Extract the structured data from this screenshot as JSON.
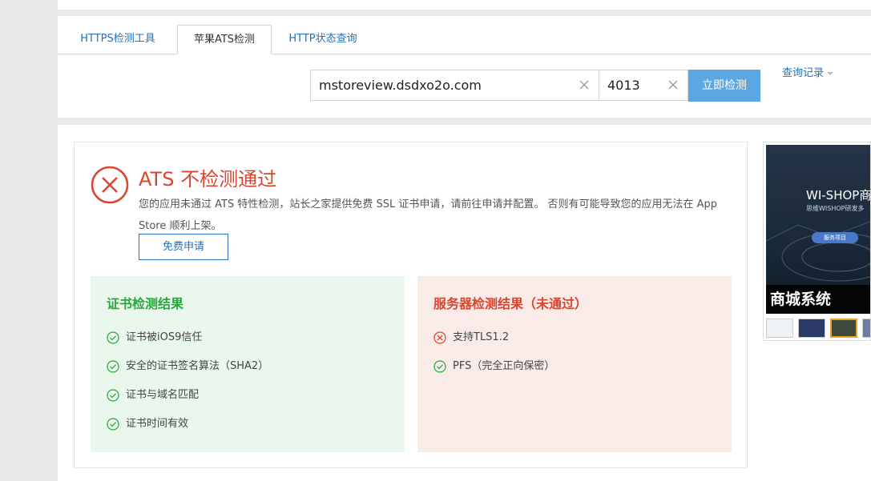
{
  "tabs": [
    {
      "label": "HTTPS检测工具"
    },
    {
      "label": "苹果ATS检测"
    },
    {
      "label": "HTTP状态查询"
    }
  ],
  "history_link": "查询记录",
  "search": {
    "domain_value": "mstoreview.dsdxo2o.com",
    "port_value": "4013",
    "submit_label": "立即检测"
  },
  "result": {
    "title": "ATS 不检测通过",
    "description": "您的应用未通过 ATS 特性检测，站长之家提供免费 SSL 证书申请，请前往申请并配置。 否则有可能导致您的应用无法在 App Store 顺利上架。",
    "apply_label": "免费申请"
  },
  "cert_panel": {
    "title": "证书检测结果",
    "items": [
      {
        "label": "证书被iOS9信任",
        "status": "pass"
      },
      {
        "label": "安全的证书签名算法（SHA2）",
        "status": "pass"
      },
      {
        "label": "证书与域名匹配",
        "status": "pass"
      },
      {
        "label": "证书时间有效",
        "status": "pass"
      }
    ]
  },
  "server_panel": {
    "title": "服务器检测结果（未通过）",
    "items": [
      {
        "label": "支持TLS1.2",
        "status": "fail"
      },
      {
        "label": "PFS（完全正向保密）",
        "status": "pass"
      }
    ]
  },
  "ad": {
    "title": "WI-SHOP商",
    "subtitle": "思维WISHOP研发多",
    "pill": "服务项目",
    "caption": "商城系统"
  },
  "colors": {
    "accent": "#2570b8",
    "button": "#5aa7e4",
    "fail": "#d9452e",
    "pass": "#2aa73c",
    "cert_bg": "#eaf7ec",
    "server_bg": "#f8ebe8"
  }
}
